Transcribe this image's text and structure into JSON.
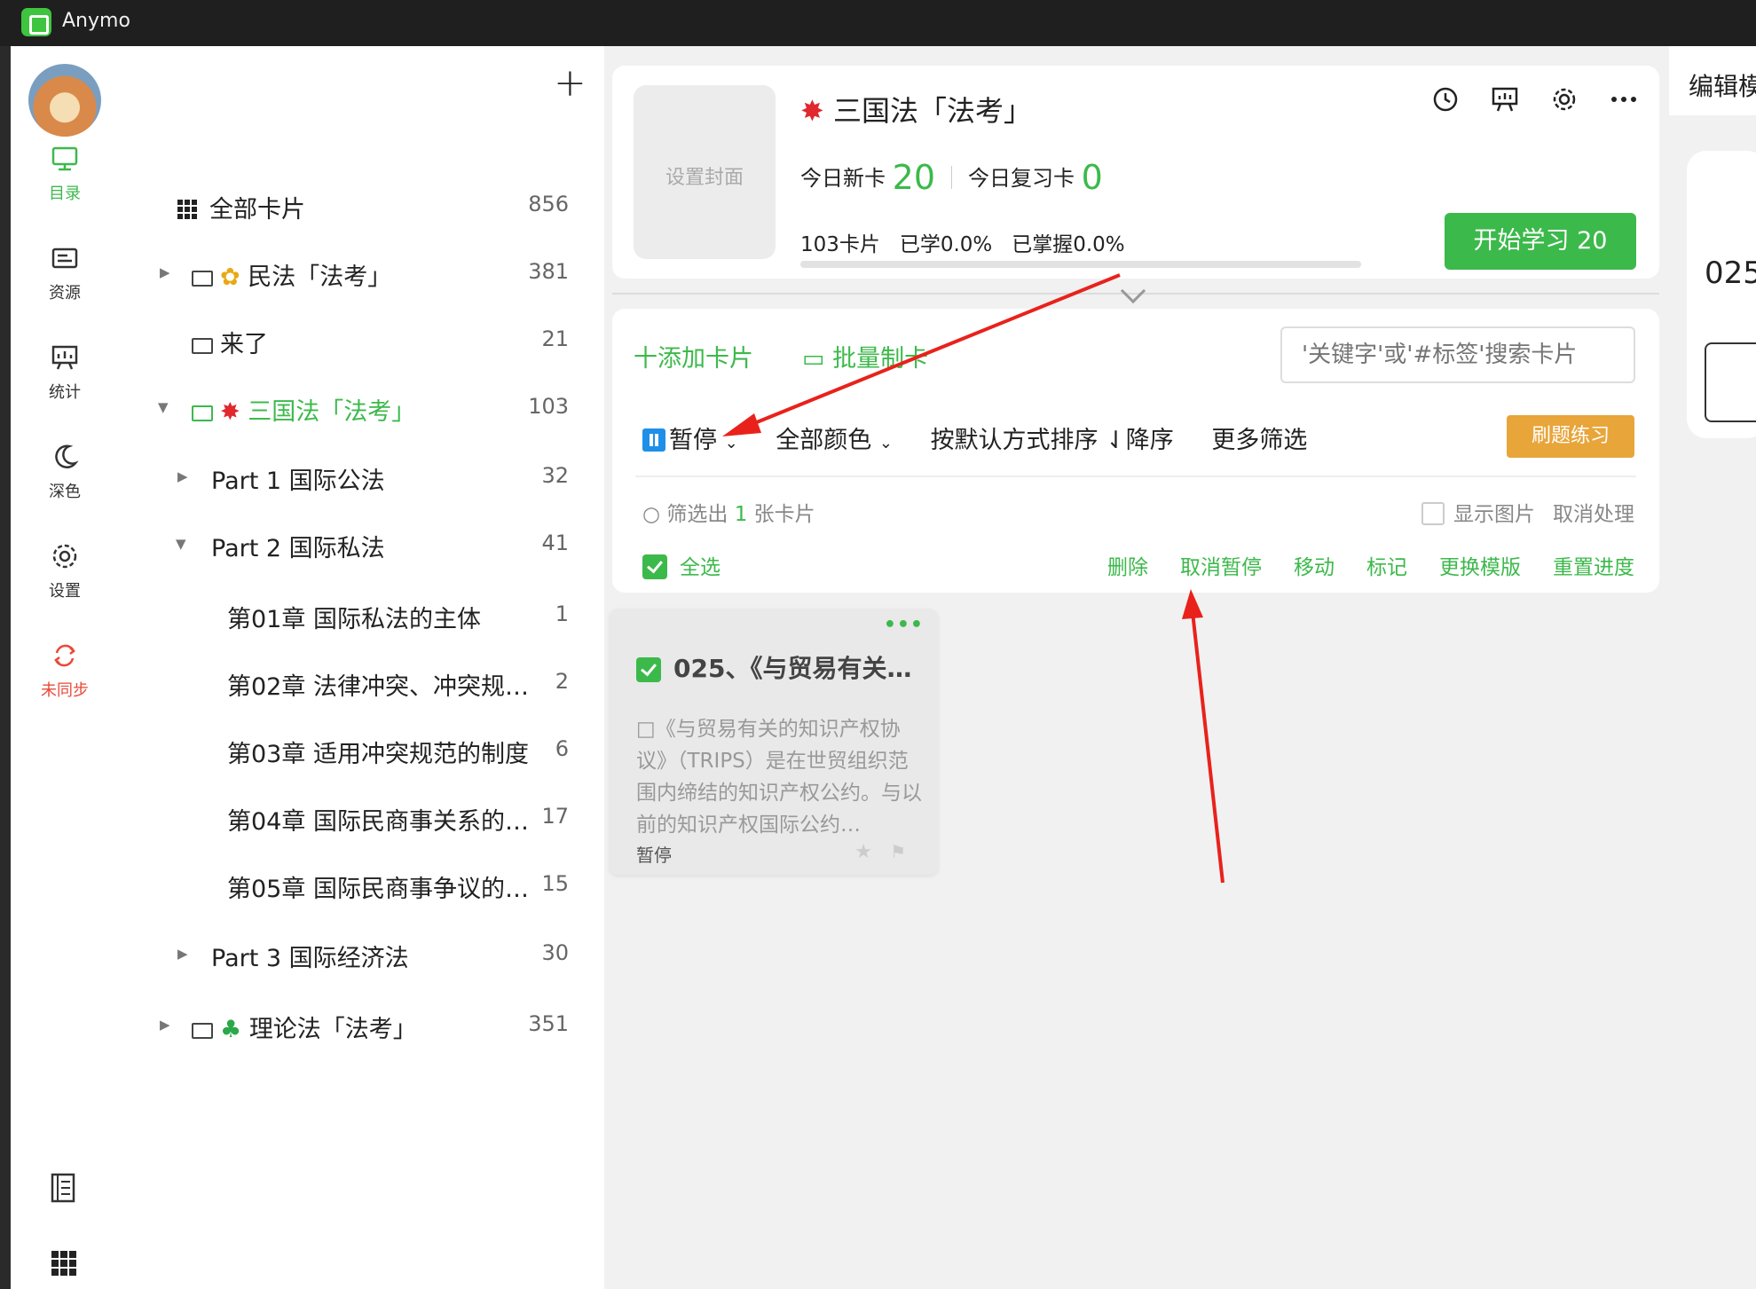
{
  "app": {
    "name": "Anymo"
  },
  "rail": {
    "items": [
      {
        "label": "目录",
        "icon": "monitor-icon"
      },
      {
        "label": "资源",
        "icon": "resource-icon"
      },
      {
        "label": "统计",
        "icon": "chart-board-icon"
      },
      {
        "label": "深色",
        "icon": "moon-icon"
      },
      {
        "label": "设置",
        "icon": "gear-icon"
      },
      {
        "label": "未同步",
        "icon": "sync-icon"
      }
    ],
    "active_color": "#3cb94b",
    "warn_color": "#e84a3a"
  },
  "tree": {
    "all": {
      "label": "全部卡片",
      "count": "856"
    },
    "rows": [
      {
        "label": "民法「法考」",
        "count": "381"
      },
      {
        "label": "来了",
        "count": "21"
      },
      {
        "label": "三国法「法考」",
        "count": "103"
      },
      {
        "label": "Part 1 国际公法",
        "count": "32"
      },
      {
        "label": "Part 2 国际私法",
        "count": "41"
      },
      {
        "label": "第01章 国际私法的主体",
        "count": "1"
      },
      {
        "label": "第02章 法律冲突、冲突规…",
        "count": "2"
      },
      {
        "label": "第03章 适用冲突规范的制度",
        "count": "6"
      },
      {
        "label": "第04章 国际民商事关系的…",
        "count": "17"
      },
      {
        "label": "第05章 国际民商事争议的…",
        "count": "15"
      },
      {
        "label": "Part 3 国际经济法",
        "count": "30"
      },
      {
        "label": "理论法「法考」",
        "count": "351"
      }
    ]
  },
  "deck": {
    "cover_label": "设置封面",
    "title": "三国法「法考」",
    "new_label": "今日新卡",
    "new_count": "20",
    "review_label": "今日复习卡",
    "review_count": "0",
    "cards": "103卡片",
    "learned": "已学0.0%",
    "mastered": "已掌握0.0%",
    "progress": 0,
    "start_label": "开始学习 20"
  },
  "panel": {
    "add_card": "十添加卡片",
    "batch": "批量制卡",
    "search_placeholder": "'关键字'或'#标签'搜索卡片",
    "filter_status": "暂停",
    "filter_color": "全部颜色",
    "sort": "按默认方式排序 ⇃降序",
    "more": "更多筛选",
    "drill": "刷题练习",
    "filtered_prefix": "筛选出",
    "filtered_count": "1",
    "filtered_suffix": "张卡片",
    "show_images": "显示图片",
    "cancel_process": "取消处理",
    "select_all": "全选",
    "actions": [
      "删除",
      "取消暂停",
      "移动",
      "标记",
      "更换模版",
      "重置进度"
    ]
  },
  "card": {
    "title": "025、《与贸易有关…",
    "body": "□《与贸易有关的知识产权协议》（TRIPS）是在世贸组织范围内缔结的知识产权公约。与以前的知识产权国际公约…",
    "tag": "暂停"
  },
  "right": {
    "edit_label": "编辑模",
    "card_num": "025"
  }
}
